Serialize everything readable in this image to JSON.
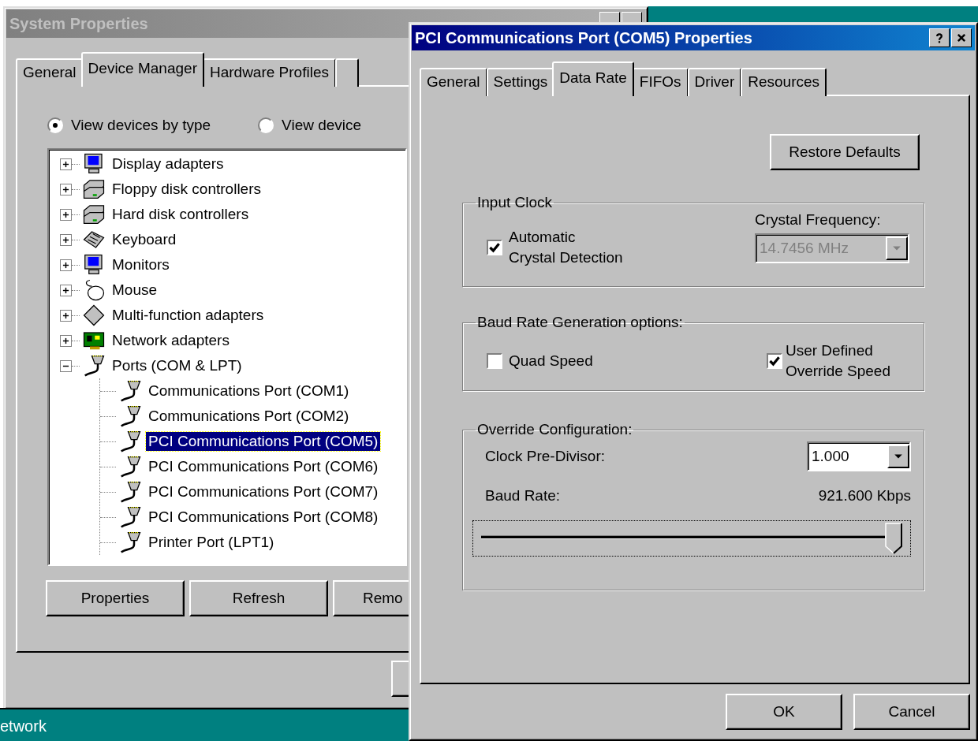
{
  "back_window": {
    "title": "System Properties",
    "active": false,
    "tabs": [
      {
        "label": "General",
        "selected": false
      },
      {
        "label": "Device Manager",
        "selected": true
      },
      {
        "label": "Hardware Profiles",
        "selected": false
      }
    ],
    "view_options": [
      {
        "label": "View devices by type",
        "selected": true
      },
      {
        "label": "View device",
        "selected": false
      }
    ],
    "tree": [
      {
        "label": "Display adapters",
        "expanded": false,
        "selected": false
      },
      {
        "label": "Floppy disk controllers",
        "expanded": false,
        "selected": false
      },
      {
        "label": "Hard disk controllers",
        "expanded": false,
        "selected": false
      },
      {
        "label": "Keyboard",
        "expanded": false,
        "selected": false
      },
      {
        "label": "Monitors",
        "expanded": false,
        "selected": false
      },
      {
        "label": "Mouse",
        "expanded": false,
        "selected": false
      },
      {
        "label": "Multi-function adapters",
        "expanded": false,
        "selected": false
      },
      {
        "label": "Network adapters",
        "expanded": false,
        "selected": false
      },
      {
        "label": "Ports (COM & LPT)",
        "expanded": true,
        "selected": false,
        "children": [
          {
            "label": "Communications Port (COM1)",
            "selected": false
          },
          {
            "label": "Communications Port (COM2)",
            "selected": false
          },
          {
            "label": "PCI Communications Port (COM5)",
            "selected": true
          },
          {
            "label": "PCI Communications Port (COM6)",
            "selected": false
          },
          {
            "label": "PCI Communications Port (COM7)",
            "selected": false
          },
          {
            "label": "PCI Communications Port (COM8)",
            "selected": false
          },
          {
            "label": "Printer Port (LPT1)",
            "selected": false
          }
        ]
      }
    ],
    "buttons": [
      "Properties",
      "Refresh",
      "Remo"
    ]
  },
  "taskbar": {
    "text": "etwork"
  },
  "front_window": {
    "title": "PCI Communications Port (COM5) Properties",
    "active": true,
    "tabs": [
      {
        "label": "General",
        "selected": false
      },
      {
        "label": "Settings",
        "selected": false
      },
      {
        "label": "Data Rate",
        "selected": true
      },
      {
        "label": "FIFOs",
        "selected": false
      },
      {
        "label": "Driver",
        "selected": false
      },
      {
        "label": "Resources",
        "selected": false
      }
    ],
    "restore_button": "Restore Defaults",
    "input_clock": {
      "title": "Input Clock",
      "auto_detect": {
        "label_lines": [
          "Automatic",
          "Crystal Detection"
        ],
        "checked": true
      },
      "frequency_label": "Crystal Frequency:",
      "frequency": {
        "value": "14.7456 MHz",
        "disabled": true
      }
    },
    "baud_options": {
      "title": "Baud Rate Generation options:",
      "quad_speed": {
        "label_lines": [
          "Quad Speed"
        ],
        "checked": false
      },
      "override_speed": {
        "label_lines": [
          "User Defined",
          "Override Speed"
        ],
        "checked": true
      }
    },
    "override": {
      "title": "Override Configuration:",
      "divisor_label": "Clock Pre-Divisor:",
      "divisor": {
        "value": "1.000",
        "disabled": false
      },
      "baud_label": "Baud Rate:",
      "baud_value": "921.600 Kbps",
      "slider": {
        "level": 1
      }
    },
    "buttons": [
      "OK",
      "Cancel"
    ]
  }
}
